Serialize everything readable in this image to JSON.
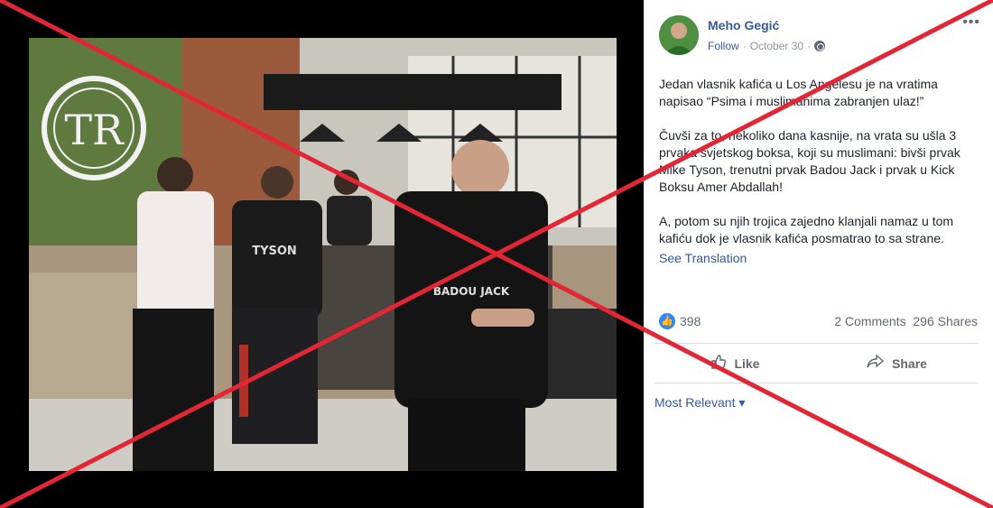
{
  "post": {
    "author": "Meho Gegić",
    "follow_label": "Follow",
    "date": "October 30",
    "separator": "·",
    "more_label": "•••",
    "paragraphs": [
      "Jedan vlasnik kafića u Los Angelesu je na vratima napisao “Psima i muslimanima zabranjen ulaz!”",
      "Čuvši za to, nekoliko dana kasnije, na vrata su ušla 3 prvaka svjetskog boksa, koji su muslimani: bivši prvak Mike Tyson, trenutni prvak Badou Jack i prvak u Kick Boksu Amer Abdallah!",
      "A, potom su njih trojica zajedno klanjali namaz u tom kafiću dok je vlasnik kafića posmatrao to sa strane."
    ],
    "see_translation": "See Translation"
  },
  "stats": {
    "reactions": "398",
    "comments": "2 Comments",
    "shares": "296 Shares"
  },
  "actions": {
    "like_label": "Like",
    "share_label": "Share"
  },
  "comments": {
    "sort_label": "Most Relevant ▾"
  },
  "photo": {
    "sign_letters": "TR",
    "shirt_text_left": "TYSON",
    "shirt_text_right": "BADOU JACK"
  },
  "colors": {
    "link": "#385898",
    "cross": "#e32636",
    "like_blue": "#2d88ff"
  },
  "icons": {
    "globe": "globe-icon",
    "like": "thumbs-up-icon",
    "share": "share-arrow-icon",
    "more": "more-dots-icon"
  }
}
